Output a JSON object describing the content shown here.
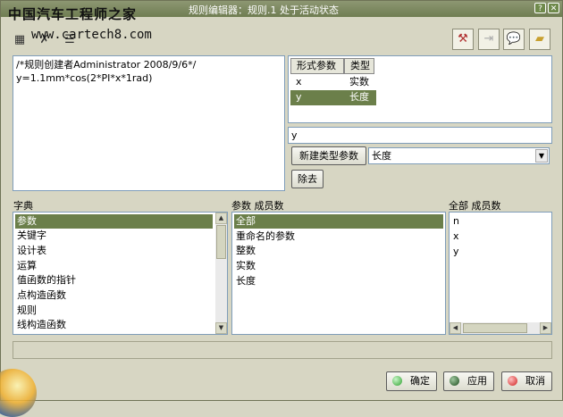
{
  "window": {
    "title": "规则编辑器：规则.1 处于活动状态",
    "watermark_line1": "中国汽车工程师之家",
    "watermark_line2": "www.cartech8.com"
  },
  "toolbar": {
    "left_icons": [
      "ruler-icon",
      "formula-icon",
      "list-icon"
    ],
    "right_tools": [
      "select-icon",
      "arrow-icon",
      "comment-icon",
      "eraser-icon"
    ]
  },
  "editor": {
    "lines": [
      "/*规则创建者Administrator 2008/9/6*/",
      "y=1.1mm*cos(2*PI*x*1rad)"
    ]
  },
  "params": {
    "headers": [
      "形式参数",
      "类型"
    ],
    "rows": [
      {
        "name": "x",
        "type": "实数",
        "selected": false
      },
      {
        "name": "y",
        "type": "长度",
        "selected": true
      }
    ],
    "name_field": "y",
    "new_type_button": "新建类型参数",
    "type_select": "长度",
    "remove_button": "除去"
  },
  "dictionary": {
    "label": "字典",
    "items": [
      "参数",
      "关键字",
      "设计表",
      "运算",
      "值函数的指针",
      "点构造函数",
      "规则",
      "线构造函数"
    ],
    "selected": 0
  },
  "members": {
    "label": "参数 成员数",
    "items": [
      "全部",
      "重命名的参数",
      "整数",
      "实数",
      "长度"
    ],
    "selected": 0
  },
  "all_members": {
    "label": "全部 成员数",
    "items": [
      "n",
      "x",
      "y"
    ]
  },
  "status": {
    "text": ""
  },
  "footer": {
    "ok_label": "确定",
    "apply_label": "应用",
    "cancel_label": "取消",
    "ok_color": "#2fa02f",
    "apply_color": "#1c4c1c",
    "cancel_color": "#d02020"
  }
}
